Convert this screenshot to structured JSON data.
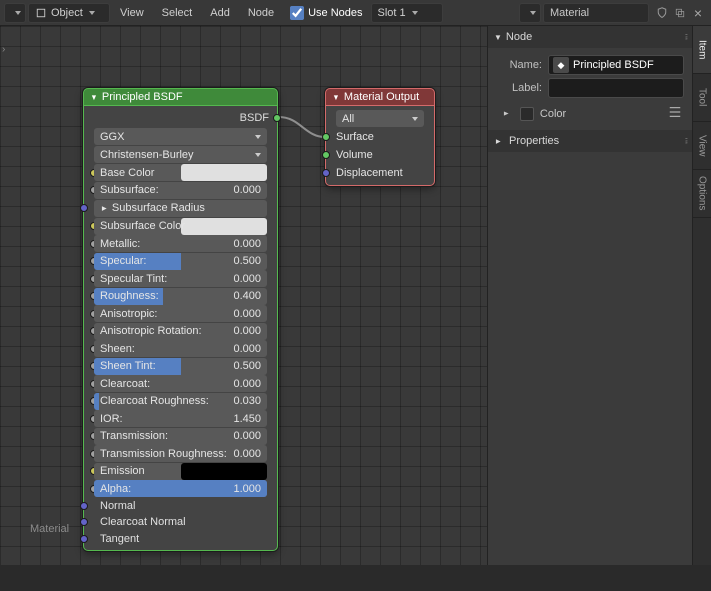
{
  "header": {
    "mode_label": "Object",
    "menus": [
      "View",
      "Select",
      "Add",
      "Node"
    ],
    "use_nodes_label": "Use Nodes",
    "use_nodes_checked": true,
    "slot_label": "Slot 1",
    "material_field": "Material",
    "shield_icon": "shield",
    "copy_icon": "copy",
    "close_icon": "×"
  },
  "canvas": {
    "breadcrumb_chevron": "›",
    "material_label": "Material"
  },
  "bsdf": {
    "title": "Principled BSDF",
    "out_socket": "BSDF",
    "distribution": "GGX",
    "sss_method": "Christensen-Burley",
    "subsurface_radius_label": "Subsurface Radius",
    "props": [
      {
        "label": "Base Color",
        "type": "swatch",
        "sock": "yellow"
      },
      {
        "label": "Subsurface:",
        "value": "0.000",
        "fill": 0,
        "sock": "grey"
      },
      {
        "label": "Subsurface Radius",
        "type": "dd_tri",
        "sock": "blue"
      },
      {
        "label": "Subsurface Color",
        "type": "swatch",
        "sock": "yellow"
      },
      {
        "label": "Metallic:",
        "value": "0.000",
        "fill": 0,
        "sock": "grey"
      },
      {
        "label": "Specular:",
        "value": "0.500",
        "fill": 0.5,
        "sock": "grey"
      },
      {
        "label": "Specular Tint:",
        "value": "0.000",
        "fill": 0,
        "sock": "grey"
      },
      {
        "label": "Roughness:",
        "value": "0.400",
        "fill": 0.4,
        "sock": "grey"
      },
      {
        "label": "Anisotropic:",
        "value": "0.000",
        "fill": 0,
        "sock": "grey"
      },
      {
        "label": "Anisotropic Rotation:",
        "value": "0.000",
        "fill": 0,
        "sock": "grey"
      },
      {
        "label": "Sheen:",
        "value": "0.000",
        "fill": 0,
        "sock": "grey"
      },
      {
        "label": "Sheen Tint:",
        "value": "0.500",
        "fill": 0.5,
        "sock": "grey"
      },
      {
        "label": "Clearcoat:",
        "value": "0.000",
        "fill": 0,
        "sock": "grey"
      },
      {
        "label": "Clearcoat Roughness:",
        "value": "0.030",
        "fill": 0.03,
        "sock": "grey"
      },
      {
        "label": "IOR:",
        "value": "1.450",
        "fill": 0,
        "sock": "grey",
        "nobar": true
      },
      {
        "label": "Transmission:",
        "value": "0.000",
        "fill": 0,
        "sock": "grey"
      },
      {
        "label": "Transmission Roughness:",
        "value": "0.000",
        "fill": 0,
        "sock": "grey"
      },
      {
        "label": "Emission",
        "type": "swatch_black",
        "sock": "yellow"
      },
      {
        "label": "Alpha:",
        "value": "1.000",
        "fill": 1,
        "sock": "grey"
      },
      {
        "label": "Normal",
        "type": "plain",
        "sock": "blue"
      },
      {
        "label": "Clearcoat Normal",
        "type": "plain",
        "sock": "blue"
      },
      {
        "label": "Tangent",
        "type": "plain",
        "sock": "blue"
      }
    ]
  },
  "material_output": {
    "title": "Material Output",
    "target": "All",
    "inputs": [
      "Surface",
      "Volume",
      "Displacement"
    ]
  },
  "sidebar": {
    "node_panel": "Node",
    "name_label": "Name:",
    "name_value": "Principled BSDF",
    "label_label": "Label:",
    "label_value": "",
    "color_label": "Color",
    "properties_panel": "Properties"
  },
  "tabs": [
    "Item",
    "Tool",
    "View",
    "Options"
  ]
}
